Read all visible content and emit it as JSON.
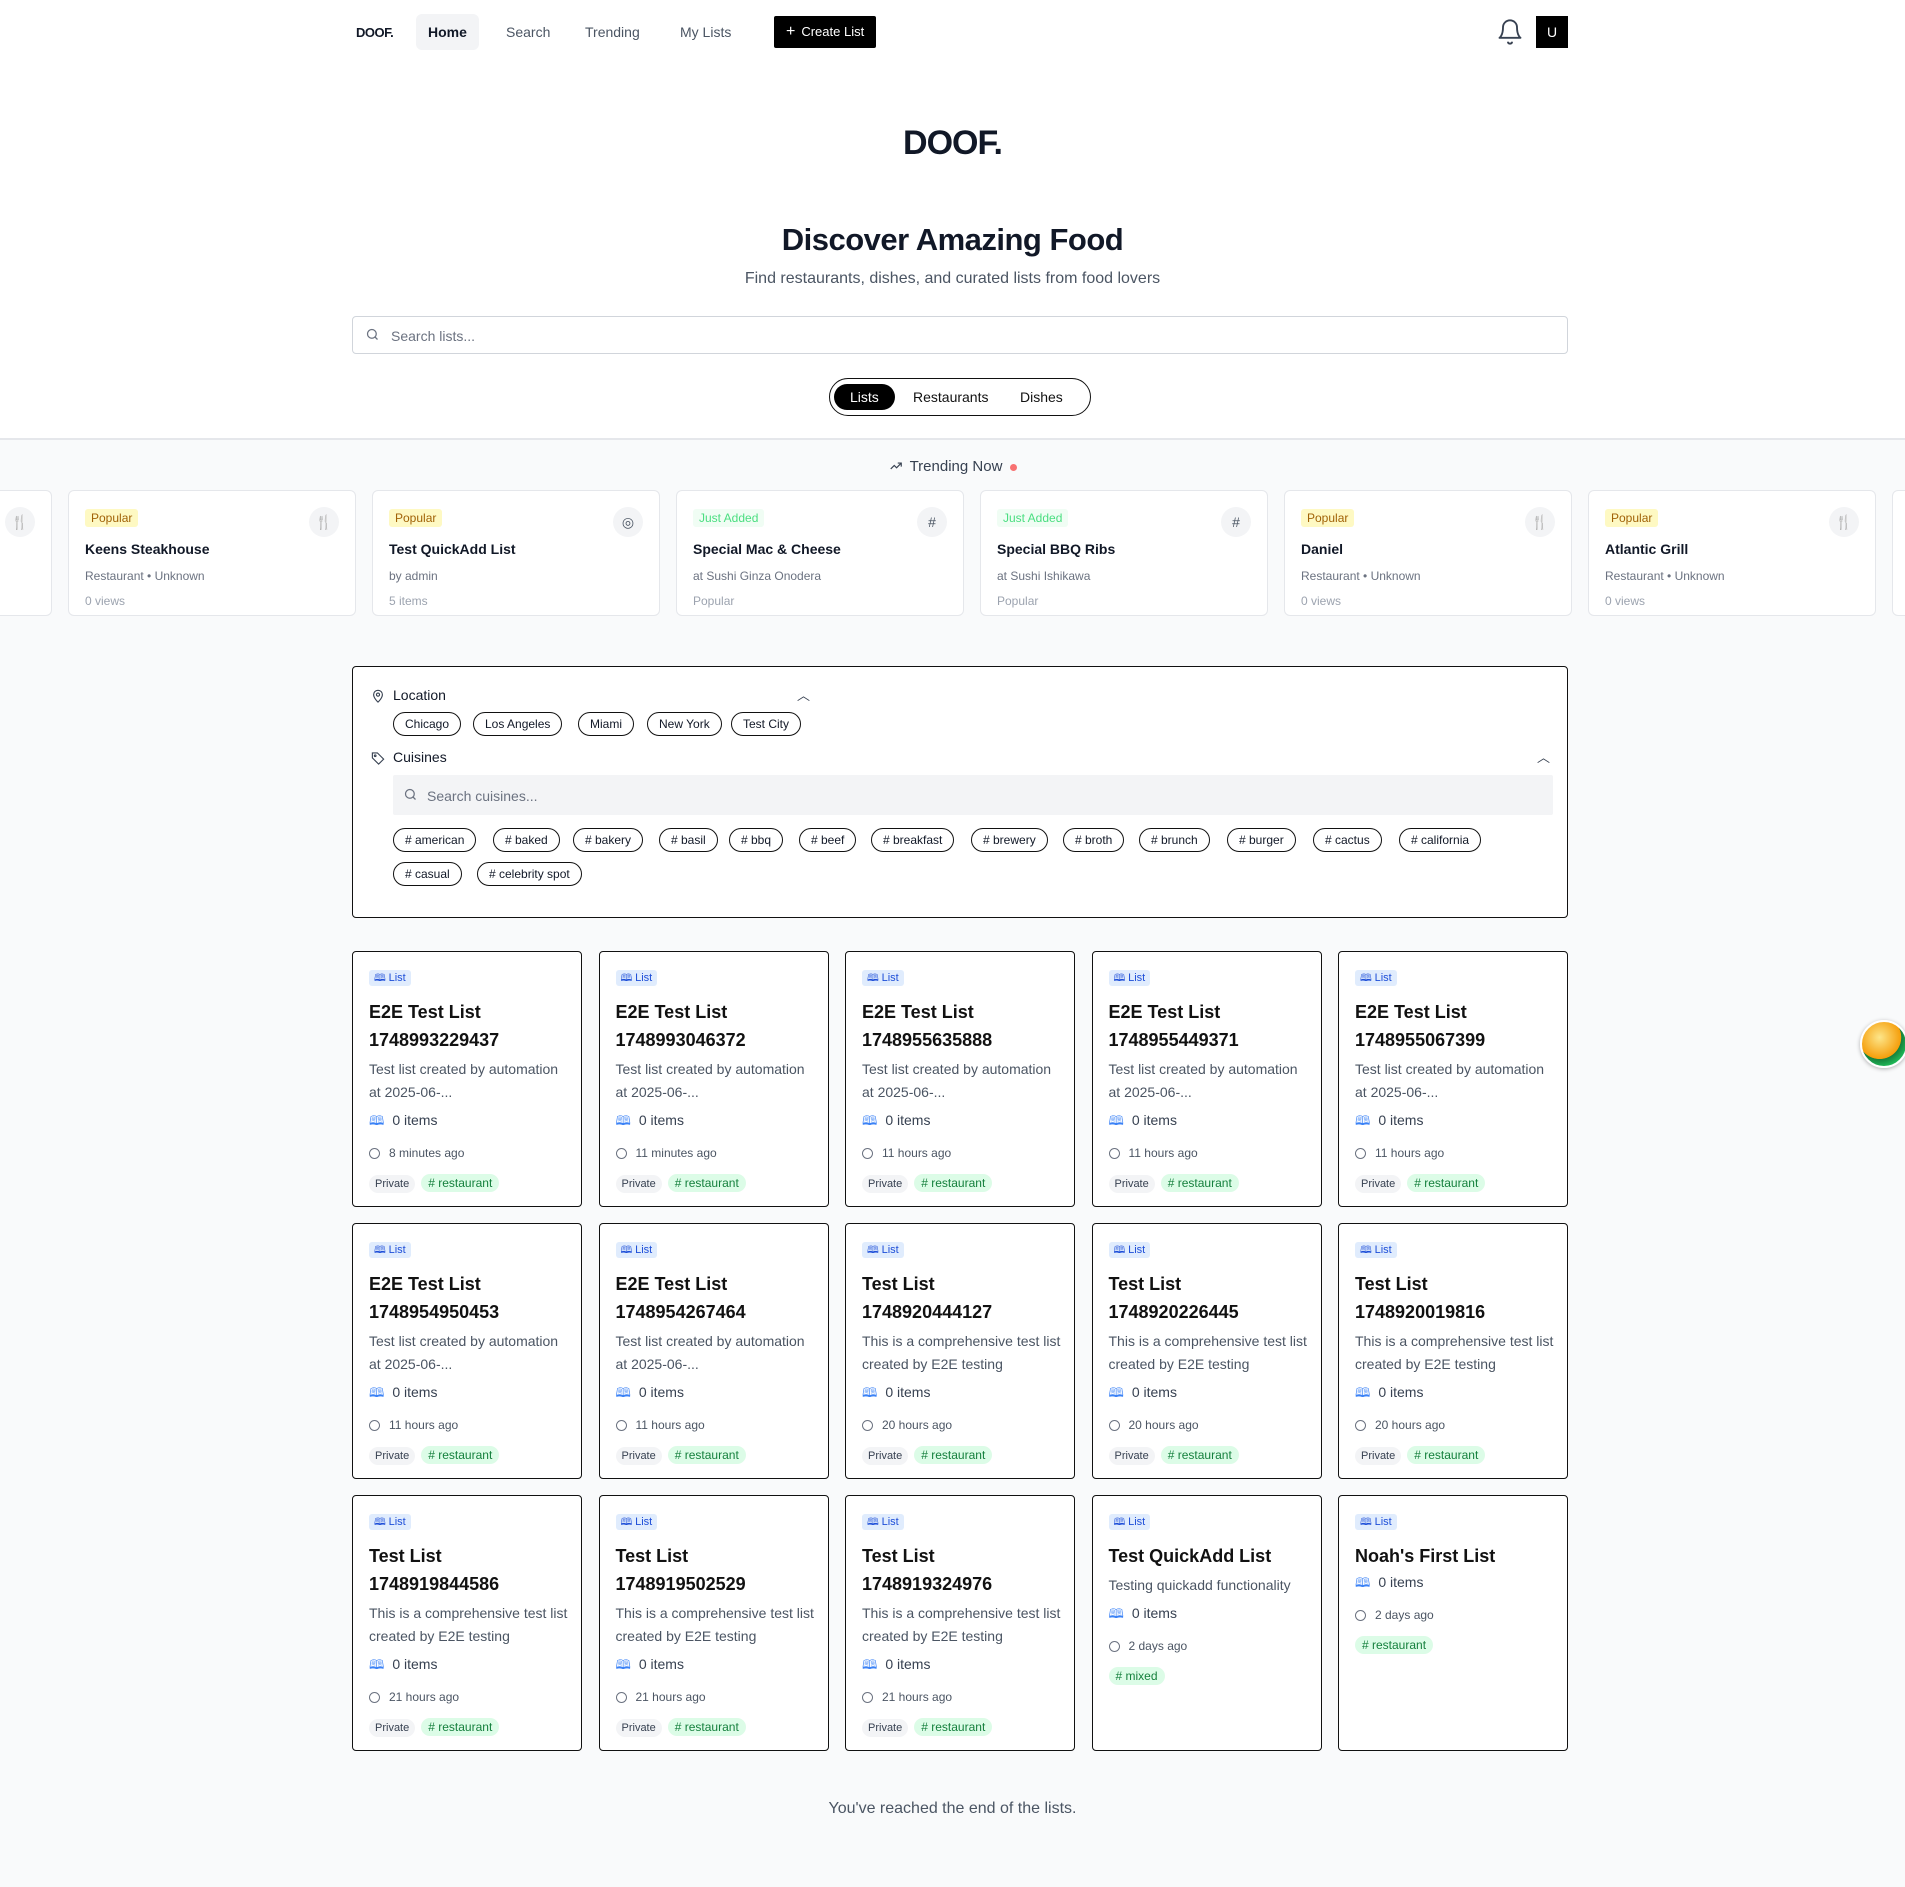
{
  "nav": {
    "logo": "DOOF.",
    "links": [
      "Home",
      "Search",
      "Trending",
      "My Lists"
    ],
    "create_label": "Create List",
    "avatar": "U"
  },
  "hero": {
    "logo": "DOOF.",
    "title": "Discover Amazing Food",
    "subtitle": "Find restaurants, dishes, and curated lists from food lovers",
    "search_placeholder": "Search lists..."
  },
  "tabs": [
    "Lists",
    "Restaurants",
    "Dishes"
  ],
  "trending": {
    "title": "Trending Now",
    "cards": [
      {
        "badge": "Popular",
        "kind": "popular",
        "icon": "utensils-icon",
        "name": "Keens Steakhouse",
        "sub": "Restaurant • Unknown",
        "meta": "0 views"
      },
      {
        "badge": "Popular",
        "kind": "popular",
        "icon": "map-pin-icon",
        "name": "Test QuickAdd List",
        "sub": "by admin",
        "meta": "5 items"
      },
      {
        "badge": "Just Added",
        "kind": "new",
        "icon": "hash-icon",
        "name": "Special Mac & Cheese",
        "sub": "at Sushi Ginza Onodera",
        "meta": "Popular"
      },
      {
        "badge": "Just Added",
        "kind": "new",
        "icon": "hash-icon",
        "name": "Special BBQ Ribs",
        "sub": "at Sushi Ishikawa",
        "meta": "Popular"
      },
      {
        "badge": "Popular",
        "kind": "popular",
        "icon": "utensils-icon",
        "name": "Daniel",
        "sub": "Restaurant • Unknown",
        "meta": "0 views"
      },
      {
        "badge": "Popular",
        "kind": "popular",
        "icon": "utensils-icon",
        "name": "Atlantic Grill",
        "sub": "Restaurant • Unknown",
        "meta": "0 views"
      }
    ]
  },
  "filters": {
    "location_label": "Location",
    "locations": [
      "Chicago",
      "Los Angeles",
      "Miami",
      "New York",
      "Test City"
    ],
    "cuisines_label": "Cuisines",
    "cuisine_search_placeholder": "Search cuisines...",
    "cuisines": [
      "# american",
      "# baked",
      "# bakery",
      "# basil",
      "# bbq",
      "# beef",
      "# breakfast",
      "# brewery",
      "# broth",
      "# brunch",
      "# burger",
      "# cactus",
      "# california",
      "# casual",
      "# celebrity spot"
    ]
  },
  "list_badge": "List",
  "cards": [
    {
      "title": "E2E Test List 1748993229437",
      "desc": "Test list created by automation at 2025-06-...",
      "items": "0 items",
      "time": "8 minutes ago",
      "privacy": "Private",
      "tag": "# restaurant"
    },
    {
      "title": "E2E Test List 1748993046372",
      "desc": "Test list created by automation at 2025-06-...",
      "items": "0 items",
      "time": "11 minutes ago",
      "privacy": "Private",
      "tag": "# restaurant"
    },
    {
      "title": "E2E Test List 1748955635888",
      "desc": "Test list created by automation at 2025-06-...",
      "items": "0 items",
      "time": "11 hours ago",
      "privacy": "Private",
      "tag": "# restaurant"
    },
    {
      "title": "E2E Test List 1748955449371",
      "desc": "Test list created by automation at 2025-06-...",
      "items": "0 items",
      "time": "11 hours ago",
      "privacy": "Private",
      "tag": "# restaurant"
    },
    {
      "title": "E2E Test List 1748955067399",
      "desc": "Test list created by automation at 2025-06-...",
      "items": "0 items",
      "time": "11 hours ago",
      "privacy": "Private",
      "tag": "# restaurant"
    },
    {
      "title": "E2E Test List 1748954950453",
      "desc": "Test list created by automation at 2025-06-...",
      "items": "0 items",
      "time": "11 hours ago",
      "privacy": "Private",
      "tag": "# restaurant"
    },
    {
      "title": "E2E Test List 1748954267464",
      "desc": "Test list created by automation at 2025-06-...",
      "items": "0 items",
      "time": "11 hours ago",
      "privacy": "Private",
      "tag": "# restaurant"
    },
    {
      "title": "Test List 1748920444127",
      "desc": "This is a comprehensive test list created by E2E testing",
      "items": "0 items",
      "time": "20 hours ago",
      "privacy": "Private",
      "tag": "# restaurant"
    },
    {
      "title": "Test List 1748920226445",
      "desc": "This is a comprehensive test list created by E2E testing",
      "items": "0 items",
      "time": "20 hours ago",
      "privacy": "Private",
      "tag": "# restaurant"
    },
    {
      "title": "Test List 1748920019816",
      "desc": "This is a comprehensive test list created by E2E testing",
      "items": "0 items",
      "time": "20 hours ago",
      "privacy": "Private",
      "tag": "# restaurant"
    },
    {
      "title": "Test List 1748919844586",
      "desc": "This is a comprehensive test list created by E2E testing",
      "items": "0 items",
      "time": "21 hours ago",
      "privacy": "Private",
      "tag": "# restaurant"
    },
    {
      "title": "Test List 1748919502529",
      "desc": "This is a comprehensive test list created by E2E testing",
      "items": "0 items",
      "time": "21 hours ago",
      "privacy": "Private",
      "tag": "# restaurant"
    },
    {
      "title": "Test List 1748919324976",
      "desc": "This is a comprehensive test list created by E2E testing",
      "items": "0 items",
      "time": "21 hours ago",
      "privacy": "Private",
      "tag": "# restaurant"
    },
    {
      "title": "Test QuickAdd List",
      "desc": "Testing quickadd functionality",
      "items": "0 items",
      "time": "2 days ago",
      "privacy": "",
      "tag": "# mixed"
    },
    {
      "title": "Noah's First List",
      "desc": "",
      "items": "0 items",
      "time": "2 days ago",
      "privacy": "",
      "tag": "# restaurant"
    }
  ],
  "end_text": "You've reached the end of the lists."
}
